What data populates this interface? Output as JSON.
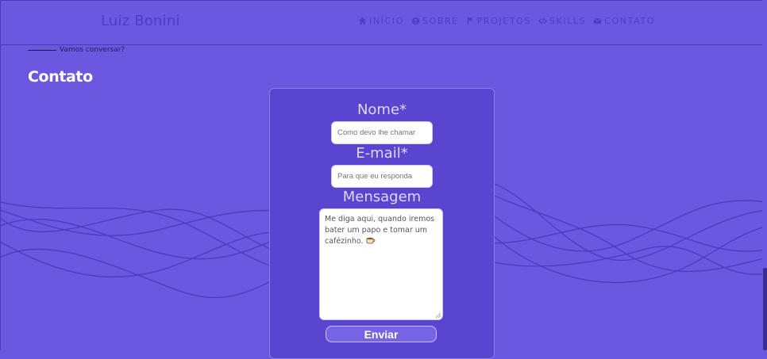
{
  "header": {
    "brand": "Luiz Bonini",
    "nav": [
      {
        "label": "INÍCIO",
        "icon": "home-icon"
      },
      {
        "label": "SOBRE",
        "icon": "user-icon"
      },
      {
        "label": "PROJETOS",
        "icon": "flag-icon"
      },
      {
        "label": "SKILLS",
        "icon": "code-icon"
      },
      {
        "label": "CONTATO",
        "icon": "mail-icon"
      }
    ]
  },
  "section": {
    "eyebrow": "Vamos conversar?",
    "title": "Contato"
  },
  "form": {
    "name_label": "Nome*",
    "name_placeholder": "Como devo lhe chamar",
    "email_label": "E-mail*",
    "email_placeholder": "Para que eu responda",
    "message_label": "Mensagem",
    "message_placeholder": "Me diga aqui, quando iremos bater um papo e tomar um cafézinho.",
    "message_emoji": "coffee-cup-icon",
    "submit_label": "Enviar"
  },
  "colors": {
    "background": "#6c57e0",
    "card": "#5a45d0",
    "nav_text": "#4e3bc8",
    "wave": "#4a36b8"
  }
}
